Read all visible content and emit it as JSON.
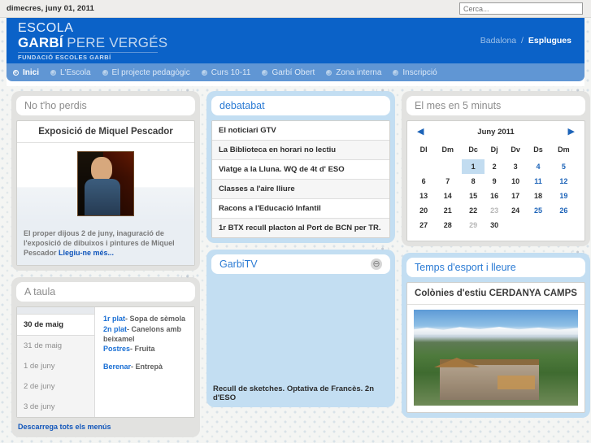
{
  "topbar": {
    "date": "dimecres, juny 01, 2011",
    "search_placeholder": "Cerca...",
    "search_value": ""
  },
  "header": {
    "logo_line1": "ESCOLA",
    "logo_garbi": "GARBÍ",
    "logo_pere_verges": "PERE VERGÉS",
    "logo_foundation": "FUNDACIÓ ESCOLES GARBÍ",
    "city_inactive": "Badalona",
    "city_separator": "/",
    "city_active": "Esplugues",
    "brand_blue": "#0b62c8"
  },
  "nav": {
    "items": [
      {
        "label": "Inici",
        "active": true
      },
      {
        "label": "L'Escola",
        "active": false
      },
      {
        "label": "El projecte pedagògic",
        "active": false
      },
      {
        "label": "Curs 10-11",
        "active": false
      },
      {
        "label": "Garbí Obert",
        "active": false
      },
      {
        "label": "Zona interna",
        "active": false
      },
      {
        "label": "Inscripció",
        "active": false
      }
    ],
    "bar_color": "#6096d4"
  },
  "widgets": {
    "handle_glyph": "‹ ● ›",
    "no_tho_perdis": {
      "title": "No t'ho perdis",
      "article_title": "Exposició de Miquel Pescador",
      "article_text": "El proper dijous 2 de juny, inaguració de l'exposició de dibuixos i pintures de Miquel Pescador ",
      "article_link": "Llegiu-ne més..."
    },
    "debatabat": {
      "title": "debatabat",
      "items": [
        "El noticiari GTV",
        "La Biblioteca en horari no lectiu",
        "Viatge a la Lluna. WQ de 4t d' ESO",
        "Classes a l'aire lliure",
        "Racons a l'Educació Infantil",
        "1r BTX recull placton al Port de BCN per TR."
      ]
    },
    "calendar": {
      "title": "El mes en 5 minuts",
      "month_label": "Juny 2011",
      "prev_arrow": "◀",
      "next_arrow": "▶",
      "daynames": [
        "Dl",
        "Dm",
        "Dc",
        "Dj",
        "Dv",
        "Ds",
        "Dm"
      ],
      "weeks": [
        [
          {
            "d": "",
            "t": "blank"
          },
          {
            "d": "",
            "t": "blank"
          },
          {
            "d": "1",
            "t": "today"
          },
          {
            "d": "2",
            "t": "day"
          },
          {
            "d": "3",
            "t": "day"
          },
          {
            "d": "4",
            "t": "wknd"
          },
          {
            "d": "5",
            "t": "wknd"
          }
        ],
        [
          {
            "d": "6",
            "t": "day"
          },
          {
            "d": "7",
            "t": "day"
          },
          {
            "d": "8",
            "t": "day"
          },
          {
            "d": "9",
            "t": "day"
          },
          {
            "d": "10",
            "t": "day"
          },
          {
            "d": "11",
            "t": "wknd"
          },
          {
            "d": "12",
            "t": "wknd"
          }
        ],
        [
          {
            "d": "13",
            "t": "day"
          },
          {
            "d": "14",
            "t": "day"
          },
          {
            "d": "15",
            "t": "day"
          },
          {
            "d": "16",
            "t": "day"
          },
          {
            "d": "17",
            "t": "day"
          },
          {
            "d": "18",
            "t": "day"
          },
          {
            "d": "19",
            "t": "wknd"
          }
        ],
        [
          {
            "d": "20",
            "t": "day"
          },
          {
            "d": "21",
            "t": "day"
          },
          {
            "d": "22",
            "t": "day"
          },
          {
            "d": "23",
            "t": "muted"
          },
          {
            "d": "24",
            "t": "day"
          },
          {
            "d": "25",
            "t": "wknd"
          },
          {
            "d": "26",
            "t": "wknd"
          }
        ],
        [
          {
            "d": "27",
            "t": "day"
          },
          {
            "d": "28",
            "t": "day"
          },
          {
            "d": "29",
            "t": "muted"
          },
          {
            "d": "30",
            "t": "day"
          },
          {
            "d": "",
            "t": "blank"
          },
          {
            "d": "",
            "t": "blank"
          },
          {
            "d": "",
            "t": "blank"
          }
        ]
      ]
    },
    "a_taula": {
      "title": "A taula",
      "dates": [
        {
          "label": "30 de maig",
          "active": true
        },
        {
          "label": "31 de maig",
          "active": false
        },
        {
          "label": "1 de juny",
          "active": false
        },
        {
          "label": "2 de juny",
          "active": false
        },
        {
          "label": "3 de juny",
          "active": false
        }
      ],
      "courses": [
        {
          "key": "1r plat",
          "value": "- Sopa de sèmola"
        },
        {
          "key": "2n plat",
          "value": "- Canelons amb beixamel"
        },
        {
          "key": "Postres",
          "value": "- Fruita"
        }
      ],
      "snack": {
        "key": "Berenar",
        "value": "- Entrepà"
      },
      "download_link": "Descarrega tots els menús"
    },
    "garbitv": {
      "title": "GarbiTV",
      "collapse_icon": "⊖",
      "caption": "Recull de sketches. Optativa de Francès. 2n d'ESO"
    },
    "esport": {
      "title": "Temps d'esport i lleure",
      "article_title": "Colònies d'estiu CERDANYA CAMPS"
    }
  }
}
